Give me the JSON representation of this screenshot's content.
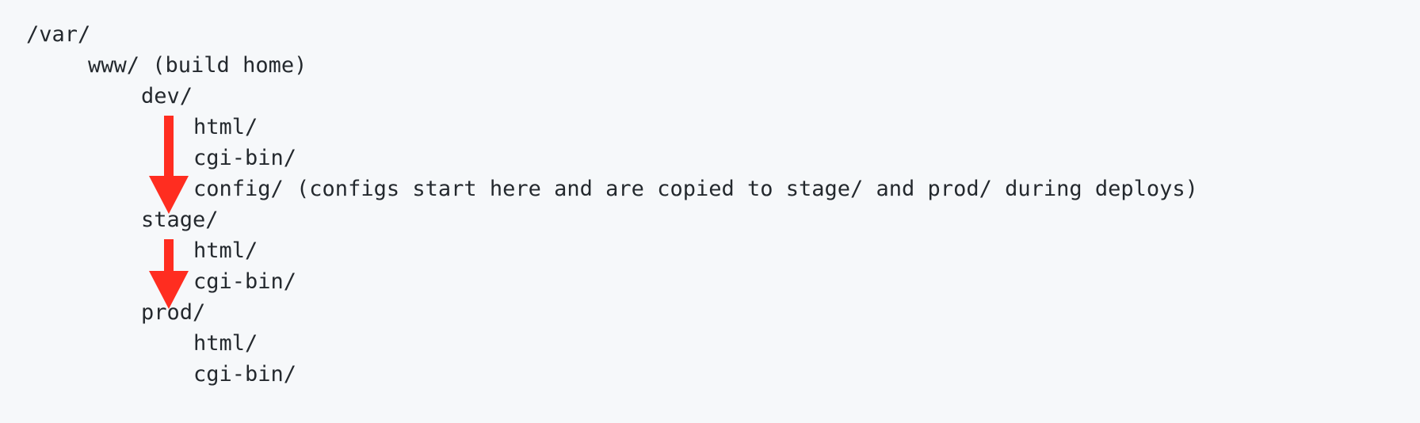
{
  "tree": {
    "lines": [
      "/var/",
      "www/ (build home)",
      "dev/",
      "html/",
      "cgi-bin/",
      "config/ (configs start here and are copied to stage/ and prod/ during deploys)",
      "stage/",
      "html/",
      "cgi-bin/",
      "prod/",
      "html/",
      "cgi-bin/"
    ]
  },
  "annotations": {
    "arrow_color": "#ff2d20",
    "arrows": [
      {
        "name": "arrow-dev-to-stage",
        "from": "dev/",
        "to": "stage/"
      },
      {
        "name": "arrow-stage-to-prod",
        "from": "stage/",
        "to": "prod/"
      }
    ]
  }
}
